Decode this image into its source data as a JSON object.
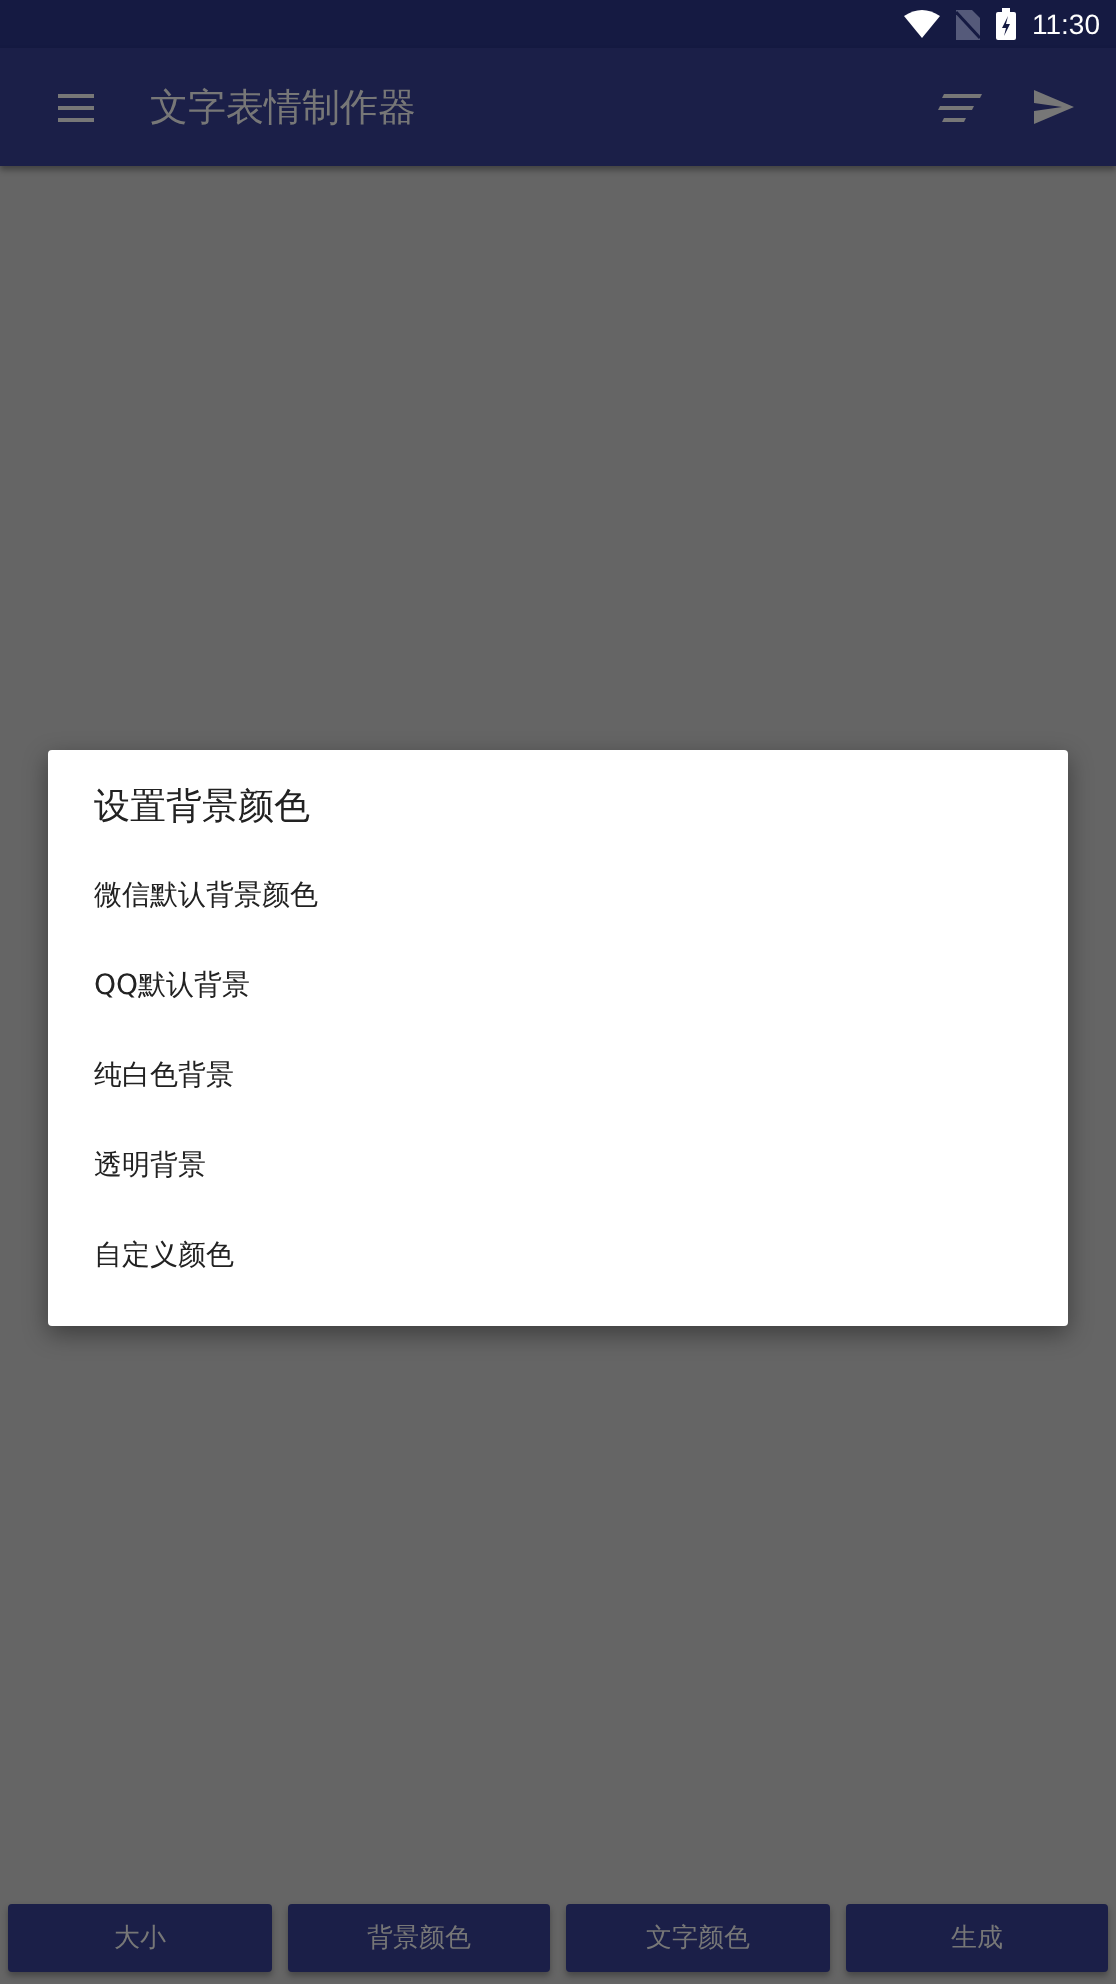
{
  "status_bar": {
    "time": "11:30"
  },
  "app_bar": {
    "title": "文字表情制作器"
  },
  "dialog": {
    "title": "设置背景颜色",
    "items": [
      {
        "label": "微信默认背景颜色"
      },
      {
        "label": "QQ默认背景"
      },
      {
        "label": "纯白色背景"
      },
      {
        "label": "透明背景"
      },
      {
        "label": "自定义颜色"
      }
    ]
  },
  "bottom_buttons": [
    {
      "label": "大小"
    },
    {
      "label": "背景颜色"
    },
    {
      "label": "文字颜色"
    },
    {
      "label": "生成"
    }
  ]
}
